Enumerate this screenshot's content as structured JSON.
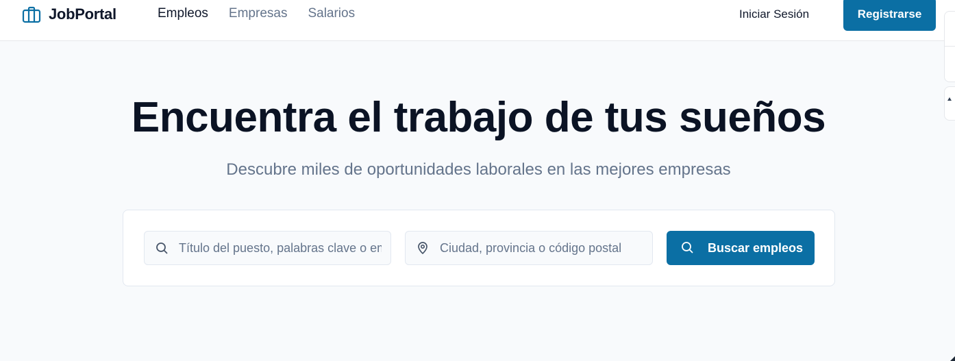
{
  "brand": {
    "name": "JobPortal",
    "icon": "briefcase-icon",
    "accent_color": "#0b6fa4"
  },
  "nav": {
    "items": [
      {
        "label": "Empleos",
        "active": true
      },
      {
        "label": "Empresas",
        "active": false
      },
      {
        "label": "Salarios",
        "active": false
      }
    ],
    "login_label": "Iniciar Sesión",
    "register_label": "Registrarse"
  },
  "hero": {
    "title": "Encuentra el trabajo de tus sueños",
    "subtitle": "Descubre miles de oportunidades laborales en las mejores empresas"
  },
  "search": {
    "keyword_placeholder": "Título del puesto, palabras clave o empresa",
    "keyword_value": "",
    "keyword_icon": "search-icon",
    "location_placeholder": "Ciudad, provincia o código postal",
    "location_value": "",
    "location_icon": "map-pin-icon",
    "button_label": "Buscar empleos",
    "button_icon": "search-icon"
  }
}
